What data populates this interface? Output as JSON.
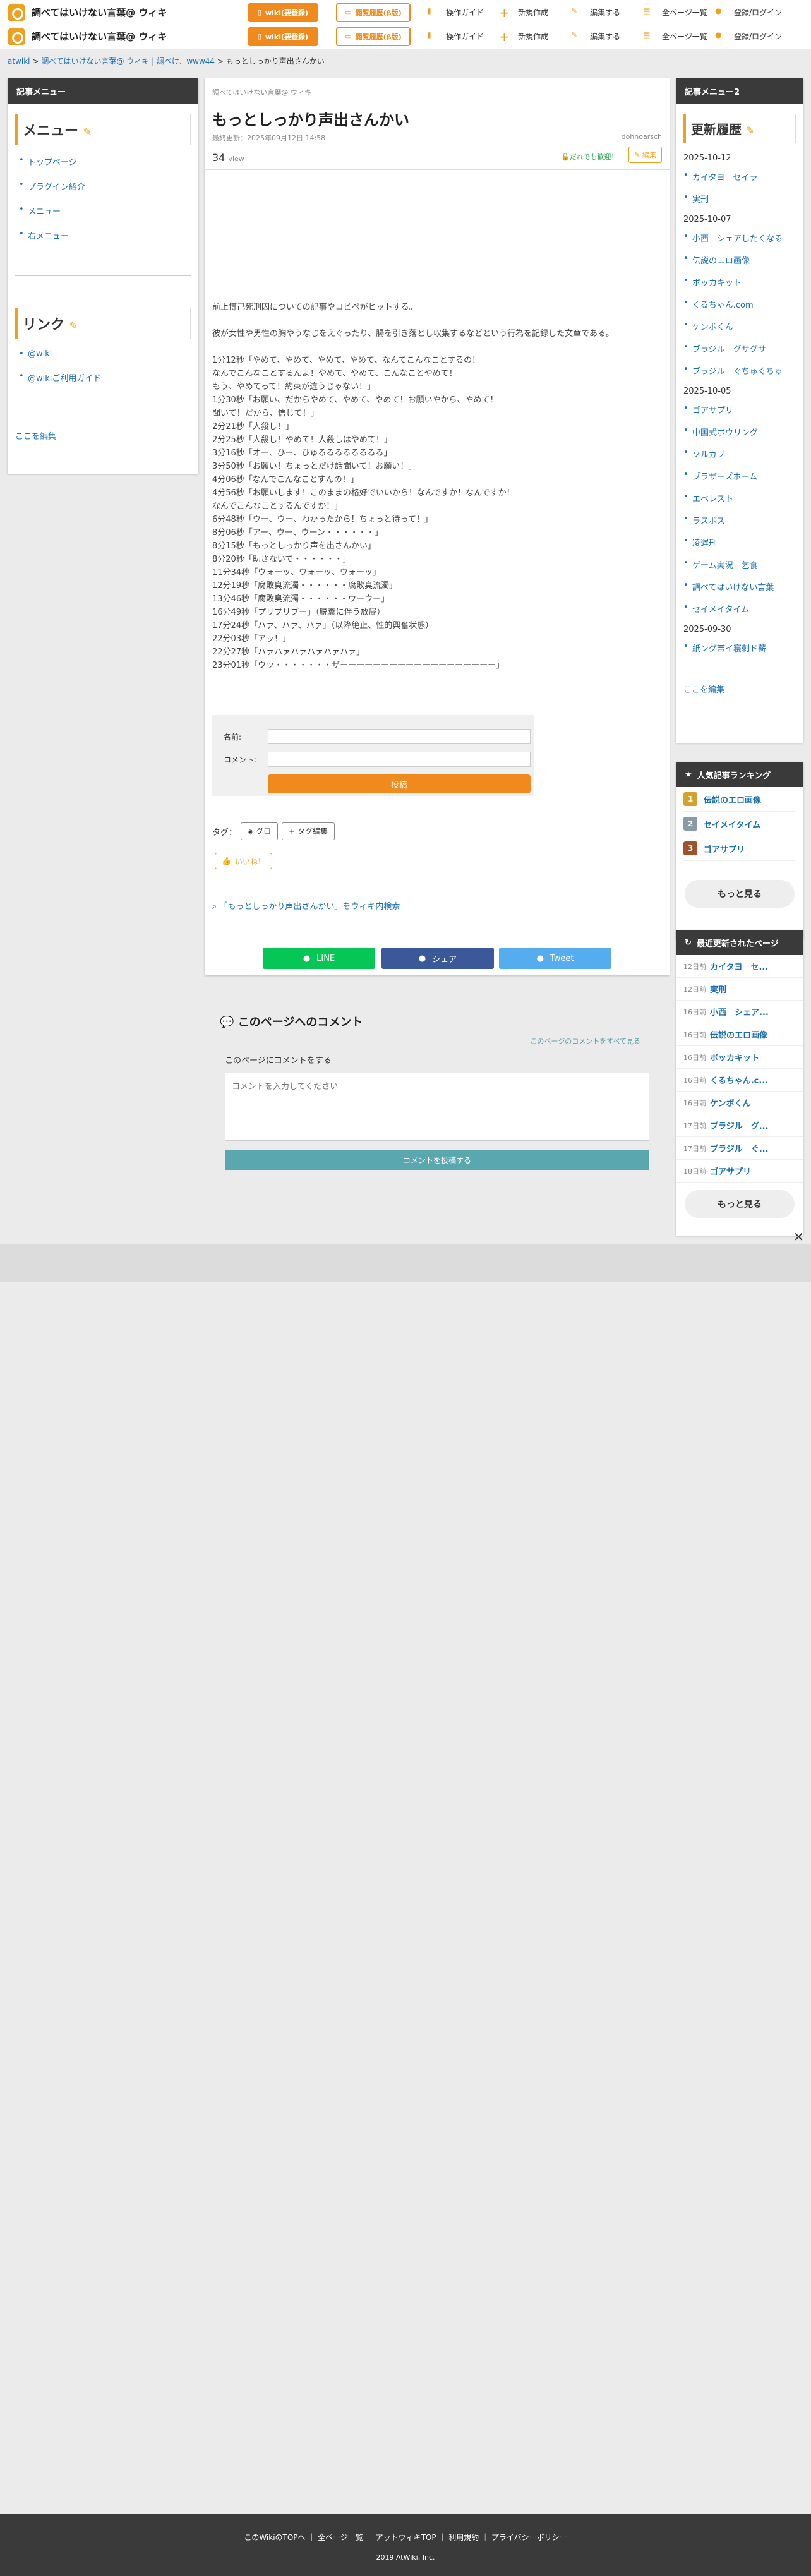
{
  "site": {
    "name": "調べてはいけない言葉@ ウィキ",
    "app_button": "wiki(要登録)",
    "history_button": "閲覧履歴(β版)"
  },
  "nav": [
    "操作ガイド",
    "新規作成",
    "編集する",
    "全ページ一覧",
    "登録/ログイン"
  ],
  "breadcrumb": {
    "root": "atwiki",
    "site": "調べてはいけない言葉@ ウィキ | 調べけ、www44",
    "current": "もっとしっかり声出さんかい"
  },
  "left": {
    "panel_title": "記事メニュー",
    "menu_heading": "メニュー",
    "menu_items": [
      "トップページ",
      "プラグイン紹介",
      "メニュー",
      "右メニュー"
    ],
    "link_heading": "リンク",
    "link_items": [
      "@wiki",
      "@wikiご利用ガイド"
    ],
    "edit_link": "ここを編集"
  },
  "article": {
    "site_label": "調べてはいけない言葉@ ウィキ",
    "title": "もっとしっかり声出さんかい",
    "updated": "最終更新：2025年09月12日 14:58",
    "author": "dohnoarsch",
    "views": "34",
    "views_label": "view",
    "trust": "だれでも歓迎！",
    "edit": "編集",
    "paragraphs": [
      "前上博己死刑囚についての記事やコピペがヒットする。",
      "",
      "彼が女性や男性の胸やうなじをえぐったり、腸を引き落とし収集するなどという行為を記録した文章である。",
      "",
      "1分12秒「やめて、やめて、やめて、やめて、なんてこんなことするの！",
      "なんでこんなことするんよ！やめて、やめて、こんなことやめて！",
      "もう、やめてって！約束が違うじゃない！」",
      "1分30秒「お願い、だからやめて、やめて、やめて！お願いやから、やめて！",
      "聞いて！だから、信じて！」",
      "2分21秒「人殺し！」",
      "2分25秒「人殺し！やめて！人殺しはやめて！」",
      "3分16秒「オー、ひー、ひゅるるるるるるるる」",
      "3分50秒「お願い！ちょっとだけ話聞いて！お願い！」",
      "4分06秒「なんでこんなことすんの！」",
      "4分56秒「お願いします！このままの格好でいいから！なんですか！なんですか！",
      "なんでこんなことするんですか！」",
      "6分48秒「ウー、ウー、わかったから！ちょっと待って！」",
      "8分06秒「アー、ウー、ウーン・・・・・・」",
      "8分15秒「もっとしっかり声を出さんかい」",
      "8分20秒「助さないで・・・・・・」",
      "11分34秒「ウォーッ、ウォーッ、ウォーッ」",
      "12分19秒「腐敗臭流濁・・・・・・腐敗臭流濁」",
      "13分46秒「腐敗臭流濁・・・・・・ウーウー」",
      "16分49秒「プリプリブー」（脱糞に伴う放屁）",
      "17分24秒「ハァ、ハァ、ハァ」（以降絶止、性的興奮状態）",
      "22分03秒「アッ！」",
      "22分27秒「ハァハァハァハァハァハァ」",
      "23分01秒「ウッ・・・・・・・ザーーーーーーーーーーーーーーーーーーー」"
    ],
    "form": {
      "name_label": "名前:",
      "comment_label": "コメント:",
      "submit": "投稿"
    },
    "tags_label": "タグ：",
    "tag": "グロ",
    "tag_edit": "タグ編集",
    "like": "いいね！",
    "search_link": "「もっとしっかり声出さんかい」をウィキ内検索",
    "share": {
      "line": "LINE",
      "facebook": "シェア",
      "twitter": "Tweet"
    }
  },
  "comments": {
    "title": "このページへのコメント",
    "see_all": "このページのコメントをすべて見る",
    "prompt": "このページにコメントをする",
    "placeholder": "コメントを入力してください",
    "submit": "コメントを投稿する"
  },
  "right": {
    "panel_title": "記事メニュー2",
    "history_heading": "更新履歴",
    "groups": [
      {
        "date": "2025-10-12",
        "items": [
          "カイタヨ　セイラ",
          "実刑"
        ]
      },
      {
        "date": "2025-10-07",
        "items": [
          "小西　シェアしたくなる",
          "伝説のエロ画像",
          "ボッカキット",
          "くるちゃん.com",
          "ケンボくん",
          "ブラジル　グサグサ",
          "ブラジル　ぐちゅぐちゅ"
        ]
      },
      {
        "date": "2025-10-05",
        "items": [
          "ゴアサプリ",
          "中国式ボウリング",
          "ソルカブ",
          "ブラザーズホーム",
          "エベレスト",
          "ラスボス",
          "凌遅刑",
          "ゲーム実況　乞食",
          "調べてはいけない言葉",
          "セイメイタイム"
        ]
      },
      {
        "date": "2025-09-30",
        "items": [
          "紙ング帯イ寝刺ド薪"
        ]
      }
    ],
    "edit_link": "ここを編集",
    "ranking_title": "人気記事ランキング",
    "ranking": [
      {
        "rank": "1",
        "title": "伝説のエロ画像",
        "color": "#d4a12a"
      },
      {
        "rank": "2",
        "title": "セイメイタイム",
        "color": "#8a9aa8"
      },
      {
        "rank": "3",
        "title": "ゴアサプリ",
        "color": "#a0522d"
      }
    ],
    "more": "もっと見る",
    "recent_title": "最近更新されたページ",
    "recent": [
      {
        "d": "12日前",
        "t": "カイタヨ　セ..."
      },
      {
        "d": "12日前",
        "t": "実刑"
      },
      {
        "d": "16日前",
        "t": "小西　シェア..."
      },
      {
        "d": "16日前",
        "t": "伝説のエロ画像"
      },
      {
        "d": "16日前",
        "t": "ボッカキット"
      },
      {
        "d": "16日前",
        "t": "くるちゃん.c..."
      },
      {
        "d": "16日前",
        "t": "ケンボくん"
      },
      {
        "d": "17日前",
        "t": "ブラジル　グ..."
      },
      {
        "d": "17日前",
        "t": "ブラジル　ぐ..."
      },
      {
        "d": "18日前",
        "t": "ゴアサプリ"
      }
    ]
  },
  "footer": {
    "links": [
      "このWikiのTOPへ",
      "全ページ一覧",
      "アットウィキTOP",
      "利用規約",
      "プライバシーポリシー"
    ],
    "copyright": "2019 AtWiki, Inc."
  }
}
